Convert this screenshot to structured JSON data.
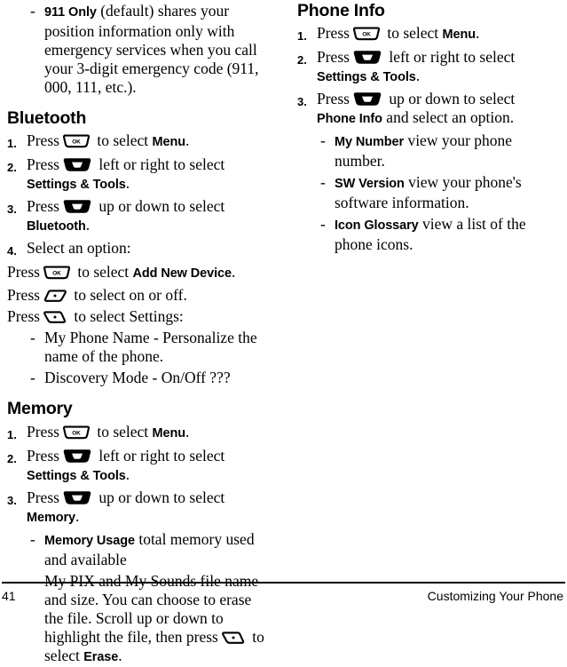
{
  "page": {
    "number": "41",
    "running_title": "Customizing Your Phone"
  },
  "icons": {
    "ok_key": "ok-key-icon",
    "ok_key_label": "OK",
    "nav_key": "navigation-key-icon",
    "left_soft_key": "left-soft-key-icon",
    "right_soft_key": "right-soft-key-icon"
  },
  "left_column": {
    "continued_item": {
      "dash": "-",
      "term": "911 Only",
      "text": " (default) shares your position information only with emergency services when you call your 3-digit emergency code (911, 000, 111, etc.)."
    },
    "bluetooth": {
      "heading": "Bluetooth",
      "steps": [
        {
          "number": "1.",
          "pre": "Press",
          "key": "ok-key-icon",
          "mid": " to select ",
          "term": "Menu",
          "post": "."
        },
        {
          "number": "2.",
          "pre": "Press",
          "key": "navigation-key-icon",
          "mid": " left or right to select ",
          "term": "Settings & Tools",
          "post": "."
        },
        {
          "number": "3.",
          "pre": "Press",
          "key": "navigation-key-icon",
          "mid": " up or down to select ",
          "term": "Bluetooth",
          "post": "."
        },
        {
          "number": "4.",
          "pre": "Select an option:",
          "key": "",
          "mid": "",
          "term": "",
          "post": ""
        }
      ],
      "option_lines": [
        {
          "pre": "Press",
          "key": "ok-key-icon",
          "mid": " to select ",
          "term": "Add New Device",
          "post": "."
        },
        {
          "pre": "Press",
          "key": "left-soft-key-icon",
          "mid": " to select on or off.",
          "term": "",
          "post": ""
        },
        {
          "pre": "Press",
          "key": "right-soft-key-icon",
          "mid": " to select Settings:",
          "term": "",
          "post": ""
        }
      ],
      "sub_items": [
        {
          "dash": "-",
          "text": "My Phone Name - Personalize the name of the phone."
        },
        {
          "dash": "-",
          "text": "Discovery Mode - On/Off ???"
        }
      ]
    },
    "memory": {
      "heading": "Memory",
      "steps": [
        {
          "number": "1.",
          "pre": "Press",
          "key": "ok-key-icon",
          "mid": " to select ",
          "term": "Menu",
          "post": "."
        },
        {
          "number": "2.",
          "pre": "Press",
          "key": "navigation-key-icon",
          "mid": " left or right to select ",
          "term": "Settings & Tools",
          "post": "."
        },
        {
          "number": "3.",
          "pre": "Press",
          "key": "navigation-key-icon",
          "mid": " up or down to select ",
          "term": "Memory",
          "post": "."
        }
      ],
      "sub_items": [
        {
          "dash": "-",
          "term": "Memory Usage",
          "text": " total memory used and available"
        }
      ],
      "pix_item": {
        "dash": "-",
        "text_before": "My PIX and My Sounds file name and size. You can choose to erase the file. Scroll up or down to highlight the file, then press",
        "key": "right-soft-key-icon",
        "text_mid": " to select ",
        "term": "Erase",
        "text_after": "."
      }
    }
  },
  "right_column": {
    "phone_info": {
      "heading": "Phone Info",
      "steps": [
        {
          "number": "1.",
          "pre": "Press",
          "key": "ok-key-icon",
          "mid": " to select ",
          "term": "Menu",
          "post": "."
        },
        {
          "number": "2.",
          "pre": "Press",
          "key": "navigation-key-icon",
          "mid": " left or right to select ",
          "term": "Settings & Tools",
          "post": "."
        },
        {
          "number": "3.",
          "pre": "Press",
          "key": "navigation-key-icon",
          "mid": " up or down to select ",
          "term": "Phone Info",
          "post": " and select an option."
        }
      ],
      "sub_items": [
        {
          "dash": "-",
          "term": "My Number",
          "text": " view your phone number."
        },
        {
          "dash": "-",
          "term": "SW Version",
          "text": " view your phone's software information."
        },
        {
          "dash": "-",
          "term": "Icon Glossary",
          "text": " view a list of the phone icons."
        }
      ]
    }
  }
}
